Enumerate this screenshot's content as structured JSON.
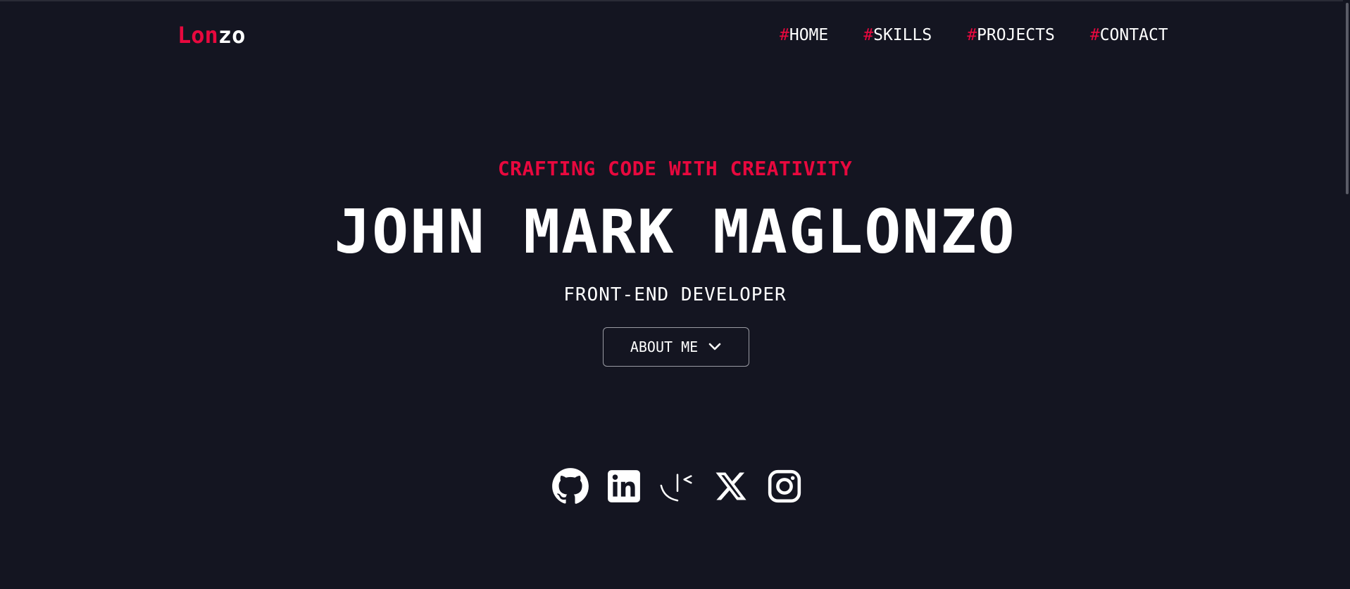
{
  "header": {
    "logo_part1": "Lon",
    "logo_part2": "zo",
    "nav": [
      {
        "hash": "#",
        "label": "HOME"
      },
      {
        "hash": "#",
        "label": "SKILLS"
      },
      {
        "hash": "#",
        "label": "PROJECTS"
      },
      {
        "hash": "#",
        "label": "CONTACT"
      }
    ]
  },
  "hero": {
    "tagline": "CRAFTING CODE WITH CREATIVITY",
    "name": "JOHN MARK MAGLONZO",
    "role": "FRONT-END DEVELOPER",
    "about_button_label": "ABOUT ME"
  },
  "socials": [
    {
      "icon": "github-icon"
    },
    {
      "icon": "linkedin-icon"
    },
    {
      "icon": "kaggle-like-icon"
    },
    {
      "icon": "x-twitter-icon"
    },
    {
      "icon": "instagram-icon"
    }
  ],
  "colors": {
    "background": "#141521",
    "accent": "#e8083e",
    "text": "#ffffff"
  }
}
